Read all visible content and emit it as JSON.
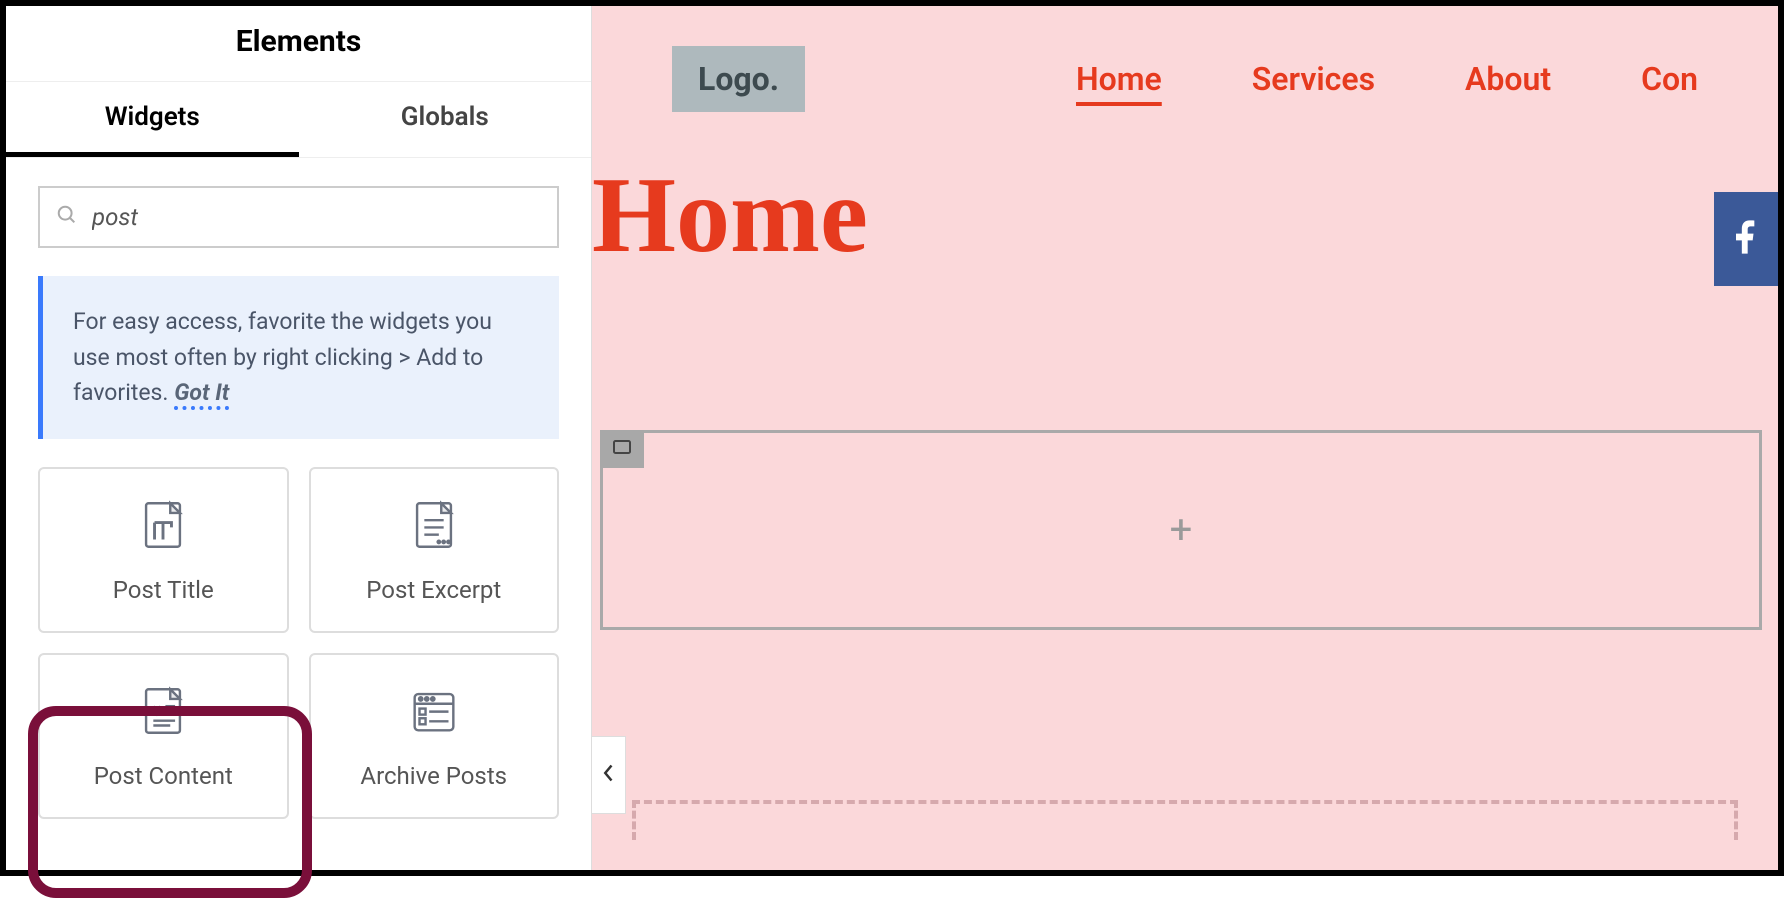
{
  "sidebar": {
    "title": "Elements",
    "tabs": {
      "widgets": "Widgets",
      "globals": "Globals"
    },
    "search_value": "post",
    "info_text": "For easy access, favorite the widgets you use most often by right clicking > Add to favorites.",
    "got_it": "Got It",
    "widgets": [
      {
        "id": "post-title",
        "label": "Post Title"
      },
      {
        "id": "post-excerpt",
        "label": "Post Excerpt"
      },
      {
        "id": "post-content",
        "label": "Post Content"
      },
      {
        "id": "archive-posts",
        "label": "Archive Posts"
      }
    ]
  },
  "canvas": {
    "logo": "Logo.",
    "nav": [
      {
        "label": "Home",
        "active": true
      },
      {
        "label": "Services",
        "active": false
      },
      {
        "label": "About",
        "active": false
      },
      {
        "label": "Con",
        "active": false
      }
    ],
    "page_title": "Home",
    "add_widget": "+"
  },
  "icons": {
    "search": "search-icon",
    "collapse": "chevron-left-icon",
    "section": "section-icon",
    "facebook": "facebook-icon"
  }
}
